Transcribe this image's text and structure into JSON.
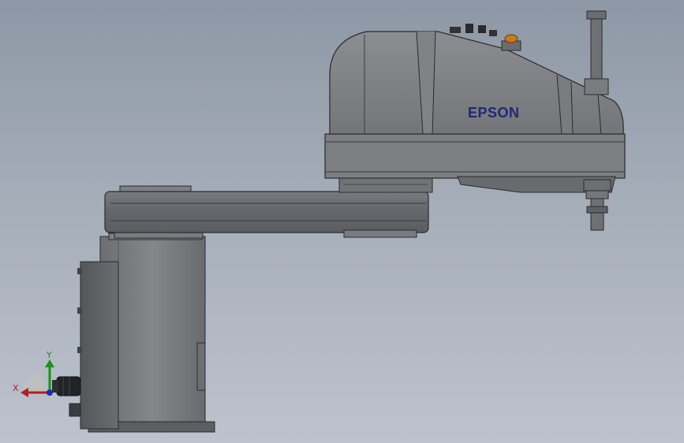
{
  "model": {
    "brand_logo": "EPSON",
    "colors": {
      "body": "#7b7c80",
      "body_dark": "#5f6064",
      "edge": "#2a2b2e",
      "arm": "#6c6d71",
      "logo": "#1d2a78",
      "indicator": "#c8791e"
    }
  },
  "triad": {
    "x_label": "X",
    "y_label": "Y",
    "x_color": "#b51f1f",
    "y_color": "#1c8f1c",
    "z_color": "#1a2fb0"
  }
}
